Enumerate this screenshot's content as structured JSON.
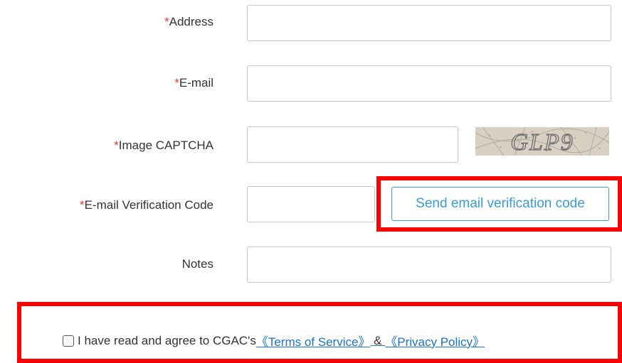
{
  "form": {
    "address": {
      "required_mark": "*",
      "label": "Address",
      "value": ""
    },
    "email": {
      "required_mark": "*",
      "label": "E-mail",
      "value": ""
    },
    "captcha": {
      "required_mark": "*",
      "label": "Image CAPTCHA",
      "value": "",
      "image_text": "GLP9"
    },
    "verification": {
      "required_mark": "*",
      "label": "E-mail Verification Code",
      "value": "",
      "send_button_label": "Send email verification code"
    },
    "notes": {
      "label": "Notes",
      "value": ""
    }
  },
  "agreement": {
    "text": "I have read and agree to CGAC's",
    "terms_link": "《Terms of Service》",
    "separator": "&",
    "privacy_link": "《Privacy Policy》",
    "checked": false
  },
  "colors": {
    "required": "#e4393c",
    "accent": "#3b9cd9",
    "link": "#1a73c8",
    "highlight": "#ff0000"
  }
}
